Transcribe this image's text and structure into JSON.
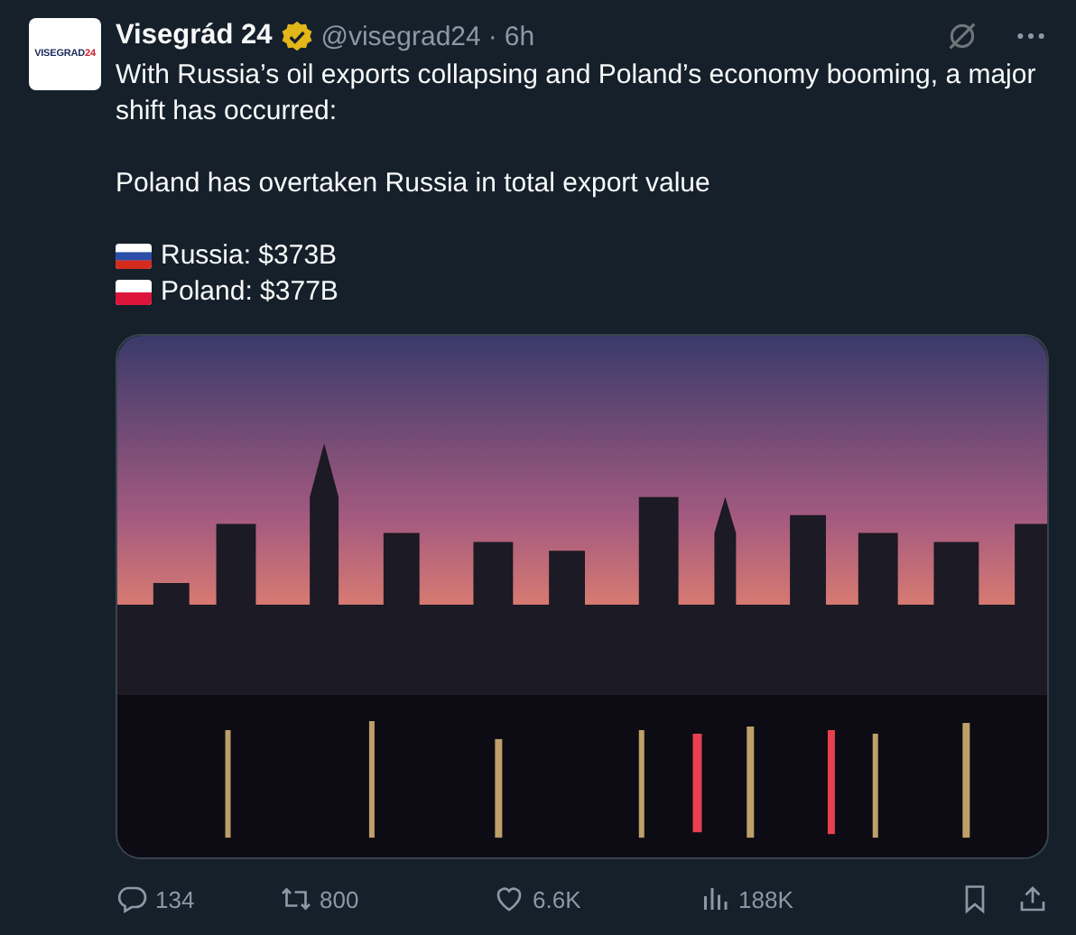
{
  "author": {
    "avatar_logo": {
      "text": "VISEGRAD",
      "accent": "24"
    },
    "name": "Visegrád 24",
    "verified": true,
    "handle": "@visegrad24",
    "separator": "·",
    "time": "6h"
  },
  "text": {
    "intro": "With Russia’s oil exports collapsing and Poland’s economy booming, a major shift has occurred:",
    "headline": "Poland has overtaken Russia in total export value"
  },
  "stats": [
    {
      "kind": "russia",
      "label": "Russia: $373B"
    },
    {
      "kind": "poland",
      "label": "Poland: $377B"
    }
  ],
  "actions": [
    {
      "kind": "reply",
      "count": "134"
    },
    {
      "kind": "repost",
      "count": "800"
    },
    {
      "kind": "like",
      "count": "6.6K"
    },
    {
      "kind": "views",
      "count": "188K"
    }
  ]
}
